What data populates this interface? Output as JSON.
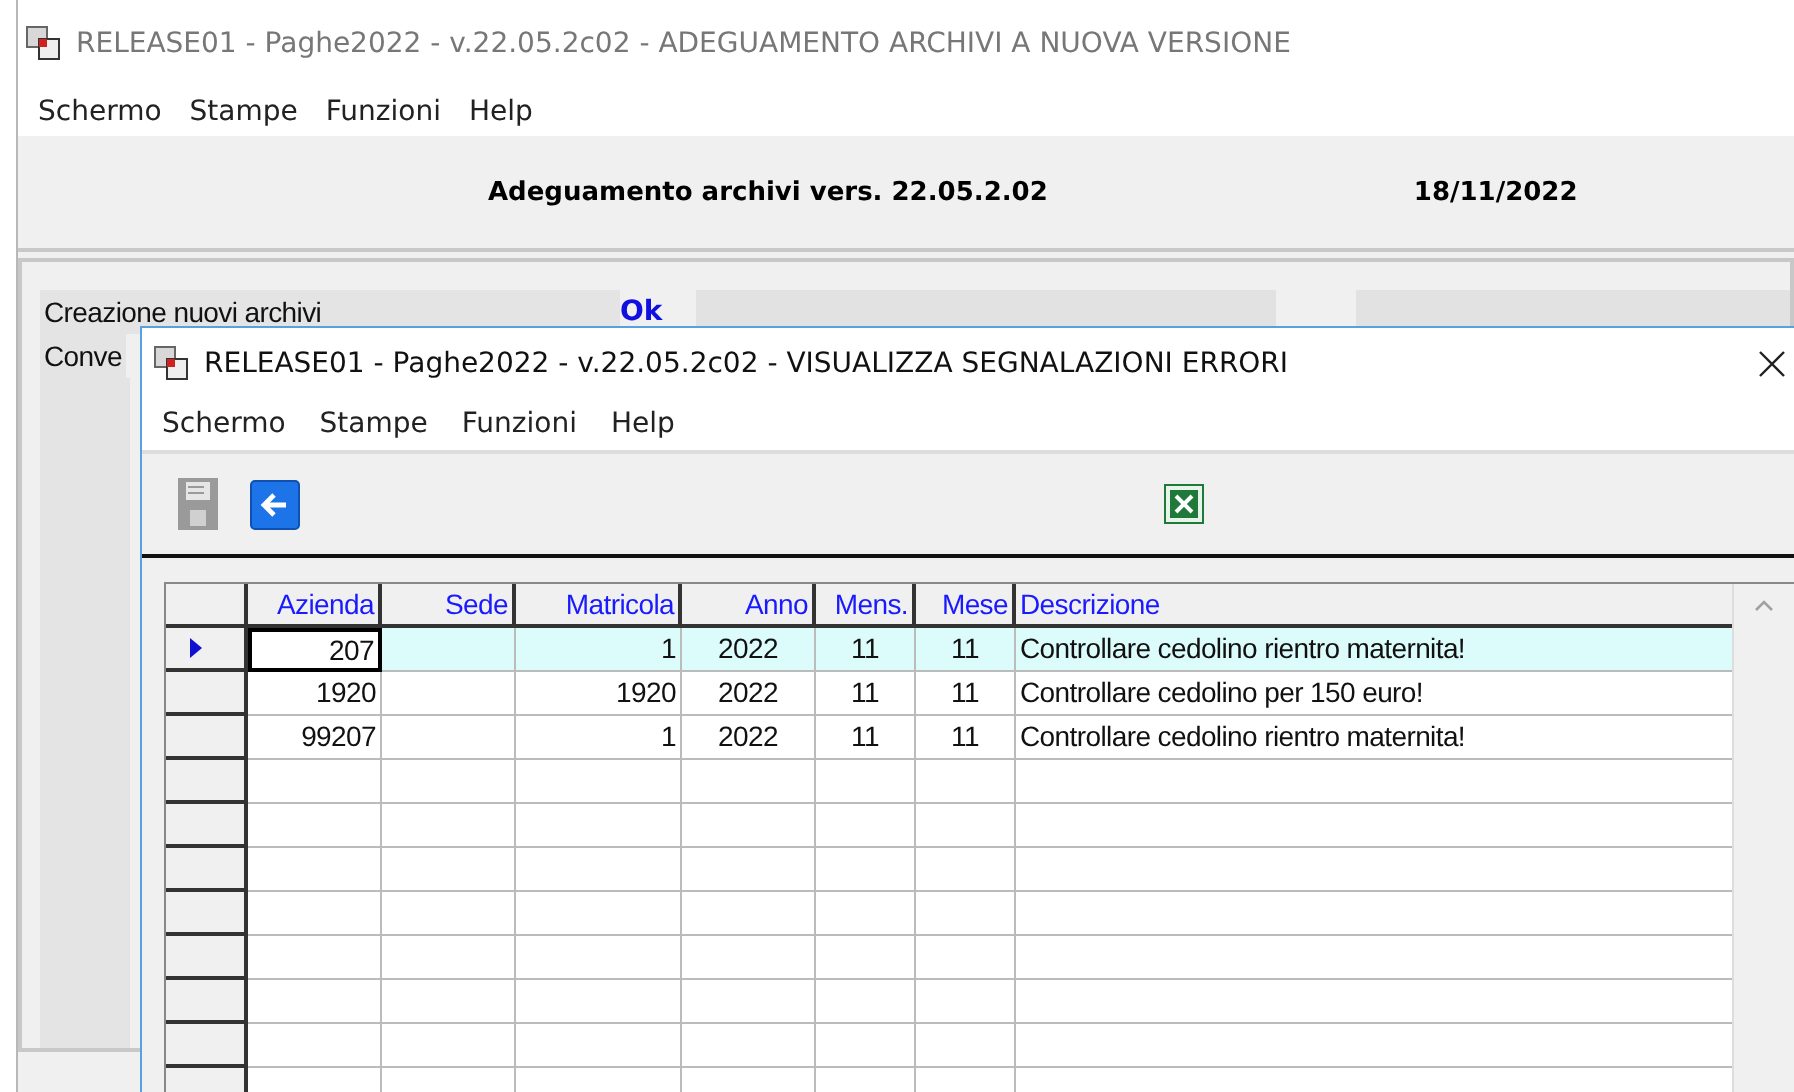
{
  "window": {
    "title": "RELEASE01 - Paghe2022 - v.22.05.2c02 - ADEGUAMENTO ARCHIVI A NUOVA VERSIONE"
  },
  "menu": [
    "Schermo",
    "Stampe",
    "Funzioni",
    "Help"
  ],
  "header": {
    "heading": "Adeguamento archivi vers. 22.05.2.02",
    "date": "18/11/2022"
  },
  "steps": [
    {
      "label": "Creazione nuovi archivi",
      "result": "Ok"
    },
    {
      "label": "Conve"
    }
  ],
  "dialog": {
    "title": "RELEASE01 - Paghe2022 - v.22.05.2c02 - VISUALIZZA SEGNALAZIONI ERRORI",
    "menu": [
      "Schermo",
      "Stampe",
      "Funzioni",
      "Help"
    ],
    "toolbar": [
      {
        "kind": "save",
        "disabled": true
      },
      {
        "kind": "back",
        "disabled": false
      },
      {
        "kind": "excel",
        "disabled": false
      }
    ],
    "table": {
      "columns": [
        "Azienda",
        "Sede",
        "Matricola",
        "Anno",
        "Mens.",
        "Mese",
        "Descrizione"
      ],
      "rows": [
        {
          "selected": true,
          "cells": [
            "207",
            "",
            "1",
            "2022",
            "11",
            "11",
            "Controllare cedolino rientro maternita!"
          ]
        },
        {
          "selected": false,
          "cells": [
            "1920",
            "",
            "1920",
            "2022",
            "11",
            "11",
            "Controllare cedolino per 150 euro!"
          ]
        },
        {
          "selected": false,
          "cells": [
            "99207",
            "",
            "1",
            "2022",
            "11",
            "11",
            "Controllare cedolino rientro maternita!"
          ]
        }
      ]
    }
  }
}
